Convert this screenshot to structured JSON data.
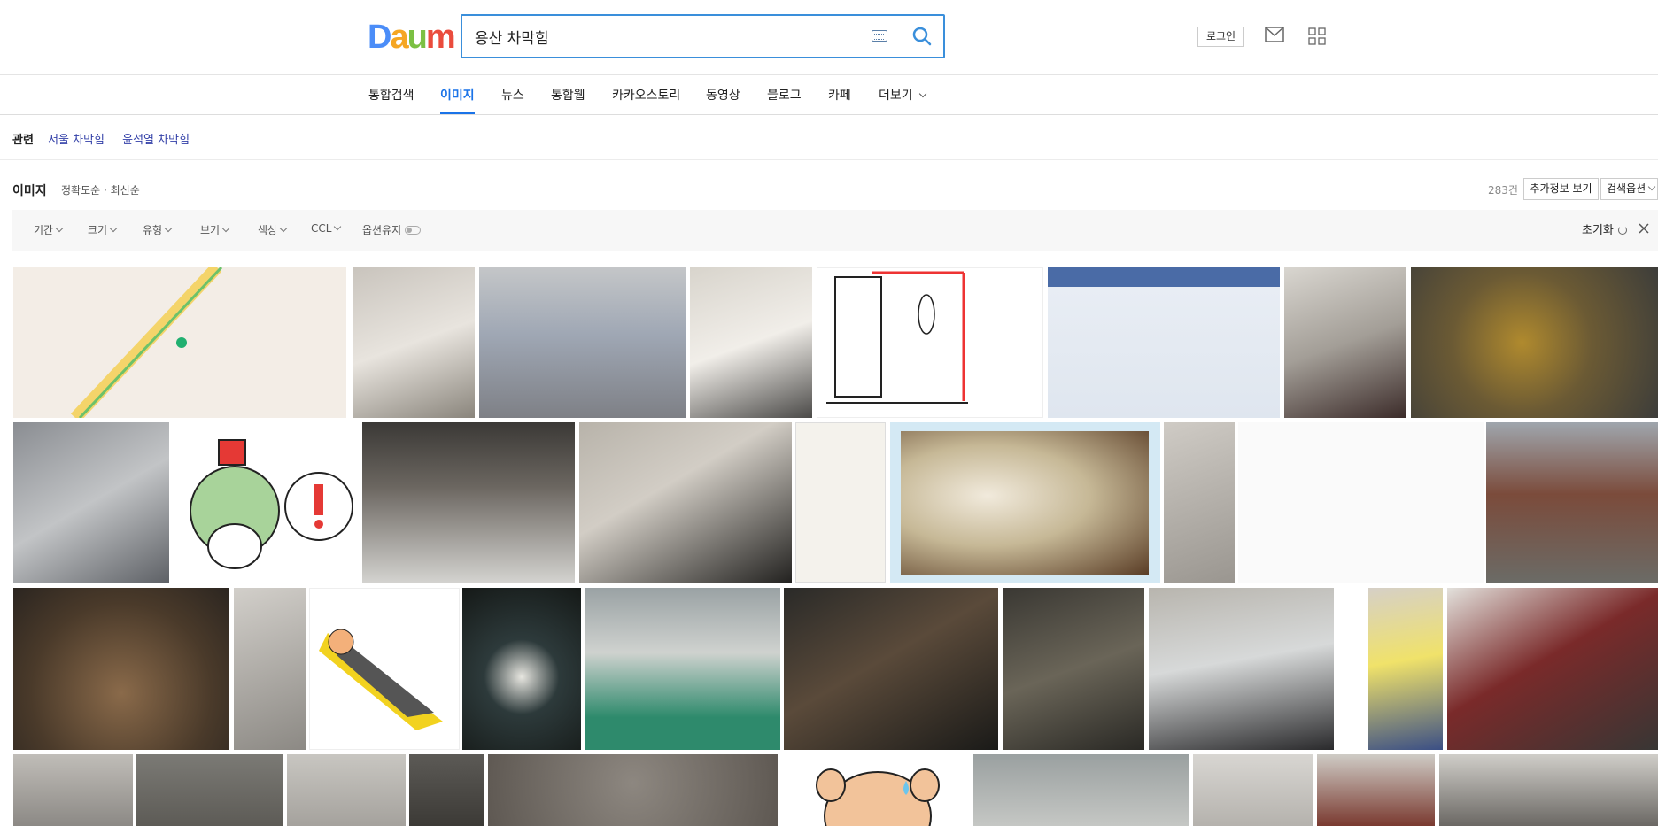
{
  "header": {
    "logo_letters": [
      "D",
      "a",
      "u",
      "m"
    ],
    "search_value": "용산 차막힘",
    "login_label": "로그인"
  },
  "nav": {
    "items": [
      "통합검색",
      "이미지",
      "뉴스",
      "통합웹",
      "카카오스토리",
      "동영상",
      "블로그",
      "카페",
      "더보기"
    ],
    "active": "이미지"
  },
  "related": {
    "label": "관련",
    "links": [
      "서울 차막힘",
      "윤석열 차막힘"
    ]
  },
  "image_bar": {
    "title": "이미지",
    "sort_options": [
      "정확도순",
      "최신순"
    ],
    "count": "283건",
    "extra_info_label": "추가정보 보기",
    "search_options_label": "검색옵션"
  },
  "filters": {
    "items": [
      "기간",
      "크기",
      "유형",
      "보기",
      "색상",
      "CCL"
    ],
    "keep_option_label": "옵션유지",
    "reset_label": "초기화"
  },
  "colors": {
    "accent": "#1a73e8",
    "search_border": "#3a8fdb",
    "link": "#3340a8"
  }
}
